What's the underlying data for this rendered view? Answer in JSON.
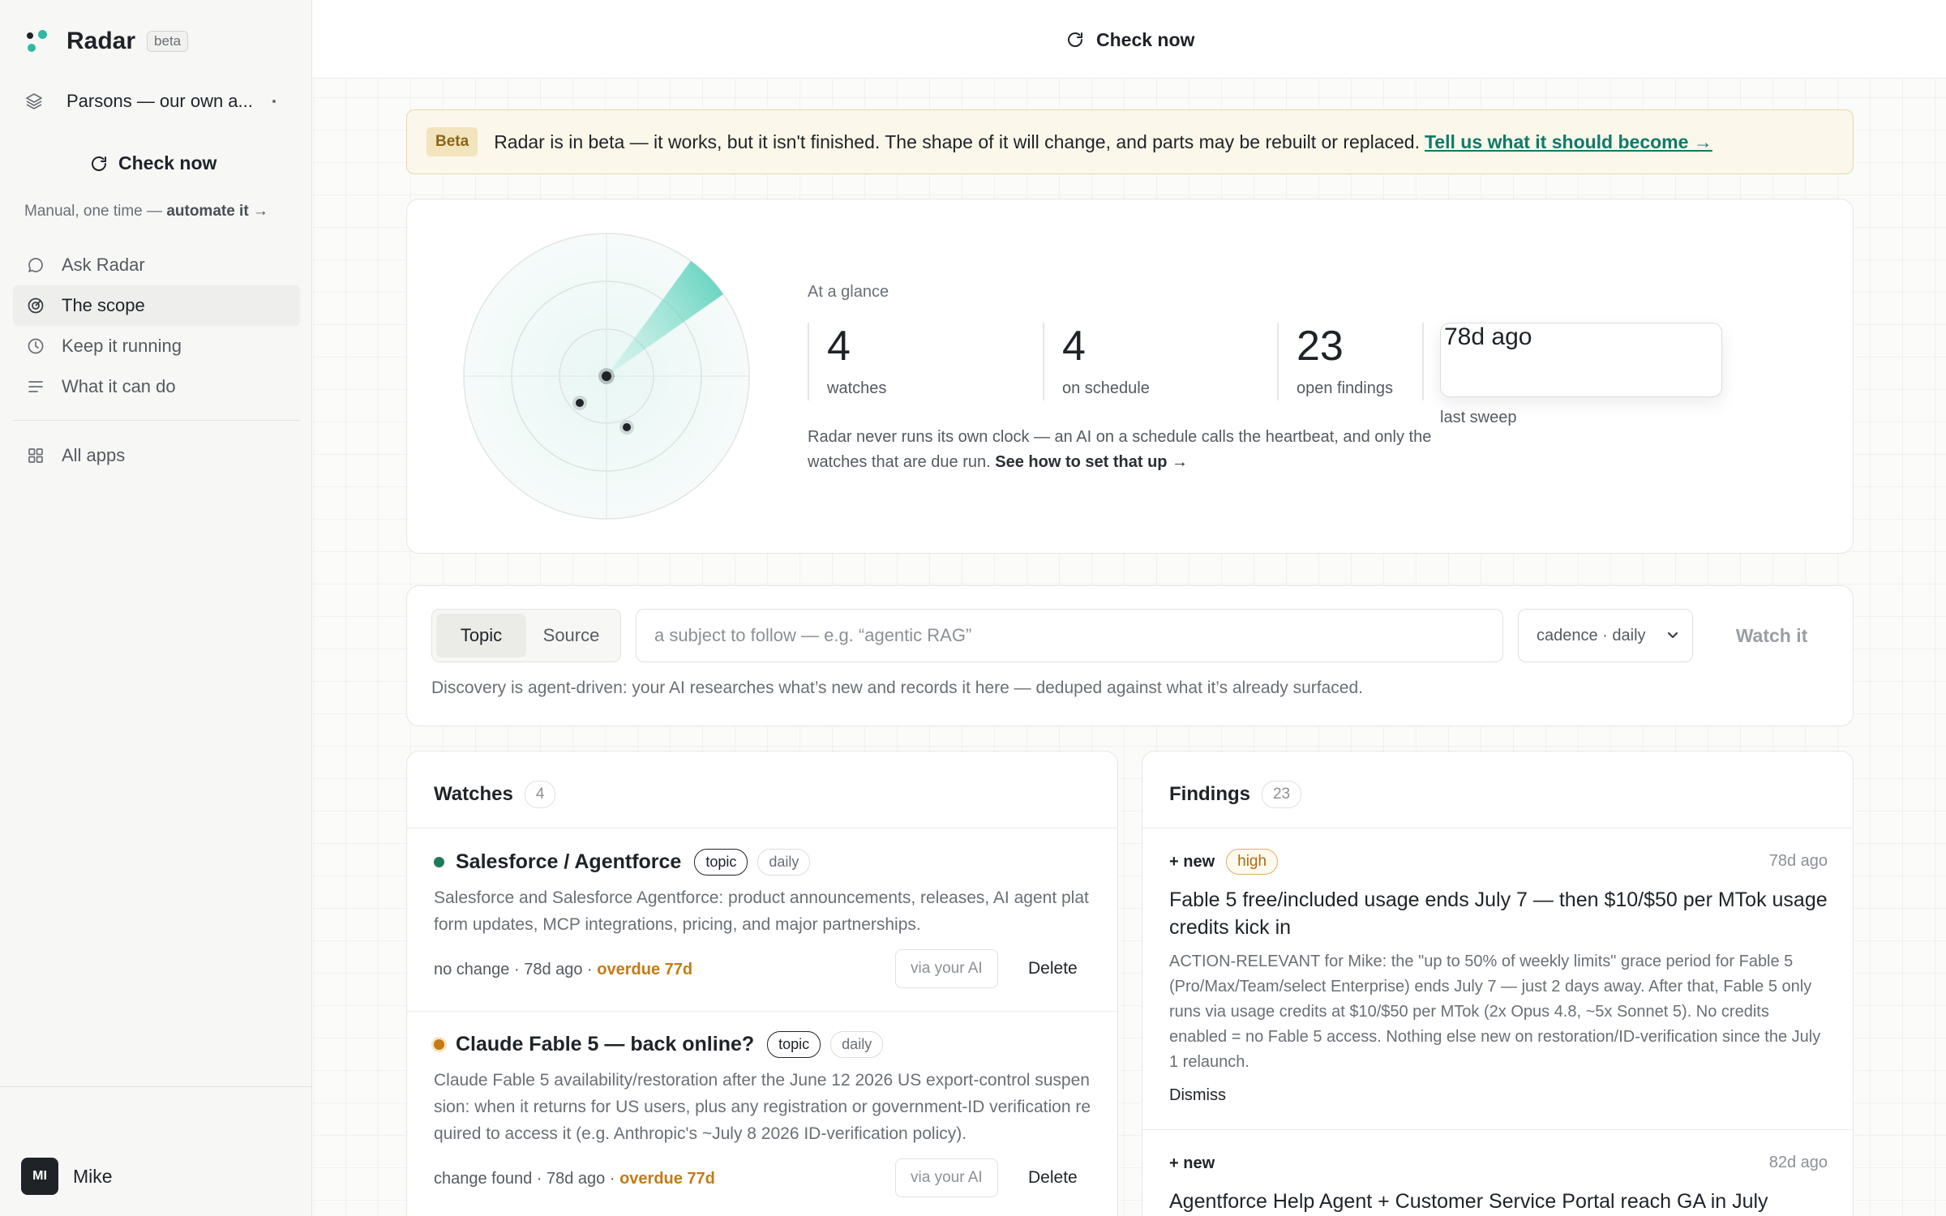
{
  "sidebar": {
    "brand": "Radar",
    "badge": "beta",
    "project": "Parsons — our own a...",
    "check_now": "Check now",
    "manual_prefix": "Manual, one time —",
    "manual_link": "automate it →",
    "nav": [
      {
        "label": "Ask Radar",
        "icon": "chat-bubble-icon"
      },
      {
        "label": "The scope",
        "icon": "target-icon"
      },
      {
        "label": "Keep it running",
        "icon": "clock-icon"
      },
      {
        "label": "What it can do",
        "icon": "list-icon"
      }
    ],
    "all_apps": "All apps",
    "user": {
      "initials": "MI",
      "name": "Mike"
    }
  },
  "topbar": {
    "check_now": "Check now"
  },
  "beta_banner": {
    "tag": "Beta",
    "text": "Radar is in beta — it works, but it isn't finished. The shape of it will change, and parts may be rebuilt or replaced.",
    "link": "Tell us what it should become →"
  },
  "glance": {
    "label": "At a glance",
    "stats": [
      {
        "value": "4",
        "label": "watches"
      },
      {
        "value": "4",
        "label": "on schedule"
      },
      {
        "value": "23",
        "label": "open findings"
      }
    ],
    "last_sweep": {
      "value": "78d ago",
      "label": "last sweep"
    },
    "note": "Radar never runs its own clock — an AI on a schedule calls the heartbeat, and only the watches that are due run.",
    "note_link": "See how to set that up →"
  },
  "new_watch": {
    "modes": [
      "Topic",
      "Source"
    ],
    "active_mode": "Topic",
    "placeholder": "a subject to follow — e.g. “agentic RAG”",
    "cadence": "cadence · daily",
    "submit": "Watch it",
    "note": "Discovery is agent-driven: your AI researches what’s new and records it here — deduped against what it’s already surfaced."
  },
  "watches": {
    "title": "Watches",
    "count": "4",
    "items": [
      {
        "title": "Salesforce / Agentforce",
        "kind": "topic",
        "cadence": "daily",
        "status_color": "#1f7a5a",
        "description": "Salesforce and Salesforce Agentforce: product announcements, releases, AI agent platform updates, MCP integrations, pricing, and major partnerships.",
        "status_text": "no change · 78d ago ·",
        "overdue": "overdue 77d",
        "via": "via your AI",
        "delete": "Delete"
      },
      {
        "title": "Claude Fable 5 — back online?",
        "kind": "topic",
        "cadence": "daily",
        "status_color": "#c47b14",
        "description": "Claude Fable 5 availability/restoration after the June 12 2026 US export-control suspension: when it returns for US users, plus any registration or government-ID verification required to access it (e.g. Anthropic's ~July 8 2026 ID-verification policy).",
        "status_text": "change found · 78d ago ·",
        "overdue": "overdue 77d",
        "via": "via your AI",
        "delete": "Delete"
      }
    ]
  },
  "findings": {
    "title": "Findings",
    "count": "23",
    "items": [
      {
        "new": "+ new",
        "severity": "high",
        "time": "78d ago",
        "title": "Fable 5 free/included usage ends July 7 — then $10/$50 per MTok usage credits kick in",
        "body": "ACTION-RELEVANT for Mike: the \"up to 50% of weekly limits\" grace period for Fable 5 (Pro/Max/Team/select Enterprise) ends July 7 — just 2 days away. After that, Fable 5 only runs via usage credits at $10/$50 per MTok (2x Opus 4.8, ~5x Sonnet 5). No credits enabled = no Fable 5 access. Nothing else new on restoration/ID-verification since the July 1 relaunch.",
        "dismiss": "Dismiss"
      },
      {
        "new": "+ new",
        "time": "82d ago",
        "title": "Agentforce Help Agent + Customer Service Portal reach GA in July"
      }
    ]
  },
  "colors": {
    "accent": "#2fb9a3",
    "link": "#0f7a6a",
    "overdue": "#c47b14"
  }
}
